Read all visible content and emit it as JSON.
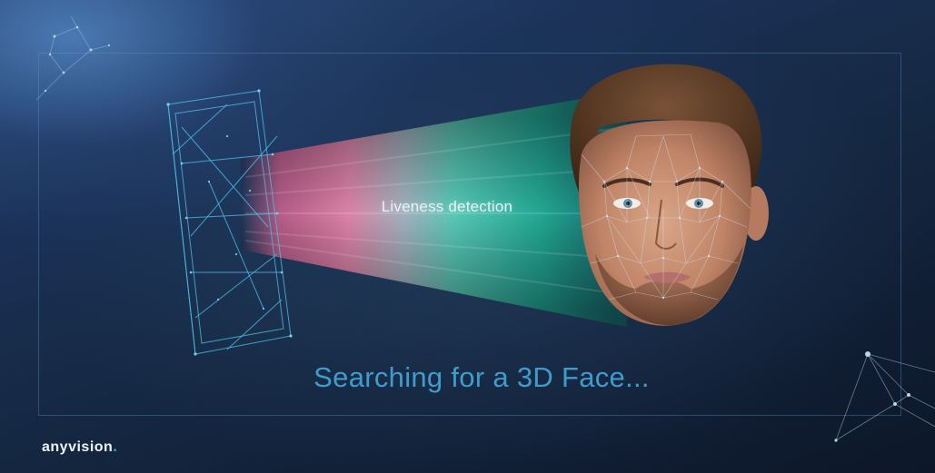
{
  "scene": {
    "beam_label": "Liveness detection",
    "caption": "Searching for a 3D Face...",
    "brand_name": "anyvision",
    "brand_dot": "."
  },
  "colors": {
    "caption": "#3f9ccc",
    "beam_pink": "#e86a9a",
    "beam_teal": "#2fc9a8",
    "mesh": "#4fc4ef",
    "background": "#152842"
  },
  "icons": {
    "phone": "wireframe-phone-icon",
    "face": "mesh-face-icon"
  }
}
